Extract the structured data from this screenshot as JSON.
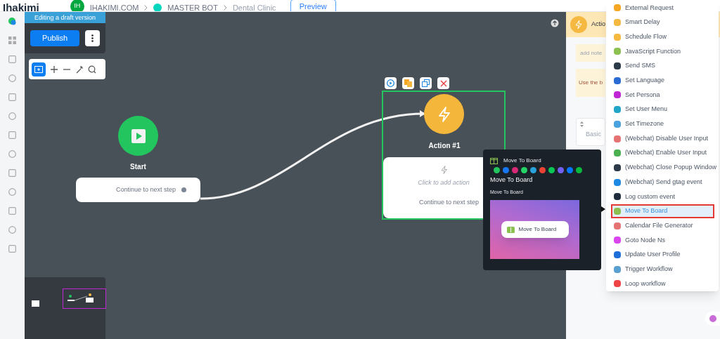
{
  "topbar": {
    "logo": "Ihakimi",
    "workspace_initials": "IH",
    "workspace": "IHAKIMI.COM",
    "bot": "MASTER BOT",
    "flow": "Dental Clinic",
    "preview_button": "Preview"
  },
  "editor_panel": {
    "banner": "Editing a draft version",
    "publish_button": "Publish"
  },
  "nodes": [
    {
      "kind": "start",
      "title": "Start",
      "card_text": "Continue to next step"
    },
    {
      "kind": "action",
      "title": "Action #1",
      "placeholder": "Click to add action",
      "card_text": "Continue to next step"
    }
  ],
  "tooltip": {
    "header": "Move To Board",
    "channels": [
      {
        "color": "#22c55e"
      },
      {
        "color": "#1877f2"
      },
      {
        "color": "#d62976"
      },
      {
        "color": "#25d366"
      },
      {
        "color": "#2aa1da"
      },
      {
        "color": "#ea4335"
      },
      {
        "color": "#06c755"
      },
      {
        "color": "#7360f2"
      },
      {
        "color": "#0077ff"
      },
      {
        "color": "#09b83e"
      }
    ],
    "title": "Move To Board",
    "subtitle": "Move To Board",
    "preview_label": "Move To Board"
  },
  "right_panel": {
    "header": "Actio",
    "note": "add note",
    "hint": "Use the b",
    "tab": "Basic"
  },
  "menu": [
    {
      "label": "External Request",
      "color": "#f5a623",
      "selected": false
    },
    {
      "label": "Smart Delay",
      "color": "#f5b942",
      "selected": false
    },
    {
      "label": "Schedule Flow",
      "color": "#f5b942",
      "selected": false
    },
    {
      "label": "JavaScript Function",
      "color": "#8cc152",
      "selected": false
    },
    {
      "label": "Send SMS",
      "color": "#2d3a4a",
      "selected": false
    },
    {
      "label": "Set Language",
      "color": "#2b6cd4",
      "selected": false
    },
    {
      "label": "Set Persona",
      "color": "#c026d3",
      "selected": false
    },
    {
      "label": "Set User Menu",
      "color": "#22a6c8",
      "selected": false
    },
    {
      "label": "Set Timezone",
      "color": "#4aa3df",
      "selected": false
    },
    {
      "label": "(Webchat) Disable User Input",
      "color": "#e57373",
      "selected": false
    },
    {
      "label": "(Webchat) Enable User Input",
      "color": "#4caf50",
      "selected": false
    },
    {
      "label": "(Webchat) Close Popup Window",
      "color": "#2d3a4a",
      "selected": false
    },
    {
      "label": "(Webchat) Send gtag event",
      "color": "#1e88e5",
      "selected": false
    },
    {
      "label": "Log custom event",
      "color": "#1f2d3d",
      "selected": false
    },
    {
      "label": "Move To Board",
      "color": "#8cc152",
      "selected": true
    },
    {
      "label": "Calendar File Generator",
      "color": "#e57373",
      "selected": false
    },
    {
      "label": "Goto Node Ns",
      "color": "#d946ef",
      "selected": false
    },
    {
      "label": "Update User Profile",
      "color": "#1e6fd9",
      "selected": false
    },
    {
      "label": "Trigger Workflow",
      "color": "#5aa0d0",
      "selected": false
    },
    {
      "label": "Loop workflow",
      "color": "#ef4444",
      "selected": false
    }
  ]
}
